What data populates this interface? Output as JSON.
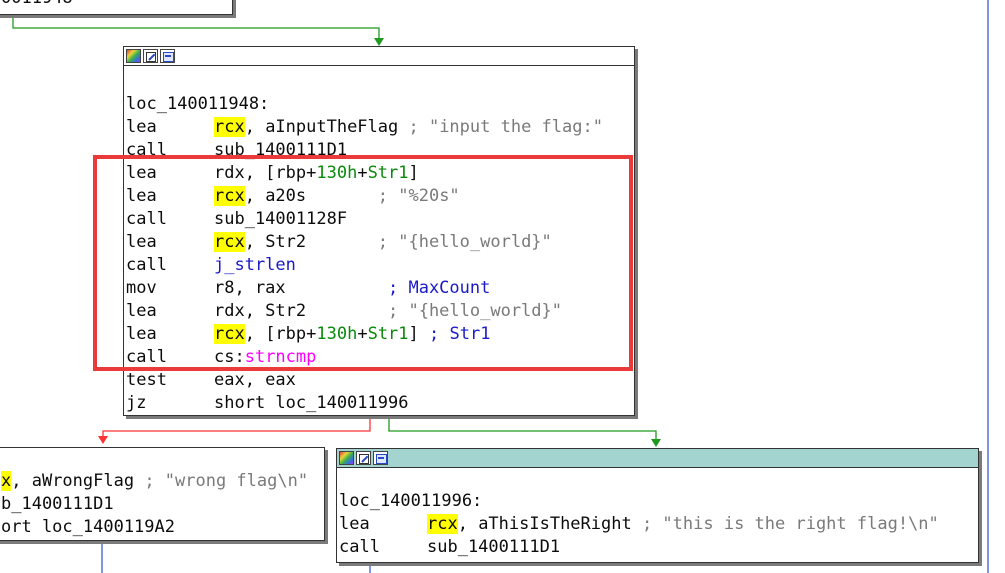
{
  "colors": {
    "edge_true": "#1f9a1f",
    "edge_false": "#ff3333",
    "edge_plain": "#3b5bdb",
    "highlight_register": "#ffff00",
    "annotation_box": "#ea3a3a",
    "node_header_teal": "#a3d4d0"
  },
  "top_stub": {
    "text": "0011948"
  },
  "main_block": {
    "header_icons": [
      "color-palette-icon",
      "rename-icon",
      "graph-overview-icon"
    ],
    "label": "loc_140011948:",
    "lines": [
      {
        "mnem": "lea",
        "reg": "rcx",
        "op_rest": ", aInputTheFlag",
        "comment": " ; \"input the flag:\""
      },
      {
        "mnem": "call",
        "op": "sub_1400111D1"
      },
      {
        "mnem": "lea",
        "op_a": "rdx, [rbp+",
        "op_green": "130h",
        "op_b": "+",
        "op_green2": "Str1",
        "op_c": "]"
      },
      {
        "mnem": "lea",
        "reg": "rcx",
        "op_rest": ", a20s       ",
        "comment": "; \"%20s\""
      },
      {
        "mnem": "call",
        "op": "sub_14001128F"
      },
      {
        "mnem": "lea",
        "reg": "rcx",
        "op_rest": ", Str2       ",
        "comment": "; \"{hello_world}\""
      },
      {
        "mnem": "call",
        "op": "j_strlen"
      },
      {
        "mnem": "mov",
        "op_a": "r8, rax          ",
        "op_blue": "; MaxCount"
      },
      {
        "mnem": "lea",
        "op_a": "rdx, Str2        ",
        "comment": "; \"{hello_world}\""
      },
      {
        "mnem": "lea",
        "reg": "rcx",
        "op_a": ", [rbp+",
        "op_green": "130h",
        "op_b": "+",
        "op_green2": "Str1",
        "op_c": "] ",
        "op_blue": "; Str1"
      },
      {
        "mnem": "call",
        "op_a": "cs:",
        "op_pink": "strncmp"
      },
      {
        "mnem": "test",
        "op": "eax, eax"
      },
      {
        "mnem": "jz",
        "op": "short loc_140011996"
      }
    ]
  },
  "left_block": {
    "lines": [
      {
        "text_hl": "x",
        "text": ", aWrongFlag ",
        "comment": "; \"wrong flag\\n\""
      },
      {
        "text": "b_1400111D1"
      },
      {
        "text": "ort loc_1400119A2"
      }
    ]
  },
  "right_block": {
    "header_icons": [
      "color-palette-icon",
      "rename-icon",
      "graph-overview-icon"
    ],
    "label": "loc_140011996:",
    "lines": [
      {
        "mnem": "lea",
        "reg": "rcx",
        "op_rest": ", aThisIsTheRight ",
        "comment": "; \"this is the right flag!\\n\""
      },
      {
        "mnem": "call",
        "op": "sub_1400111D1"
      }
    ]
  }
}
